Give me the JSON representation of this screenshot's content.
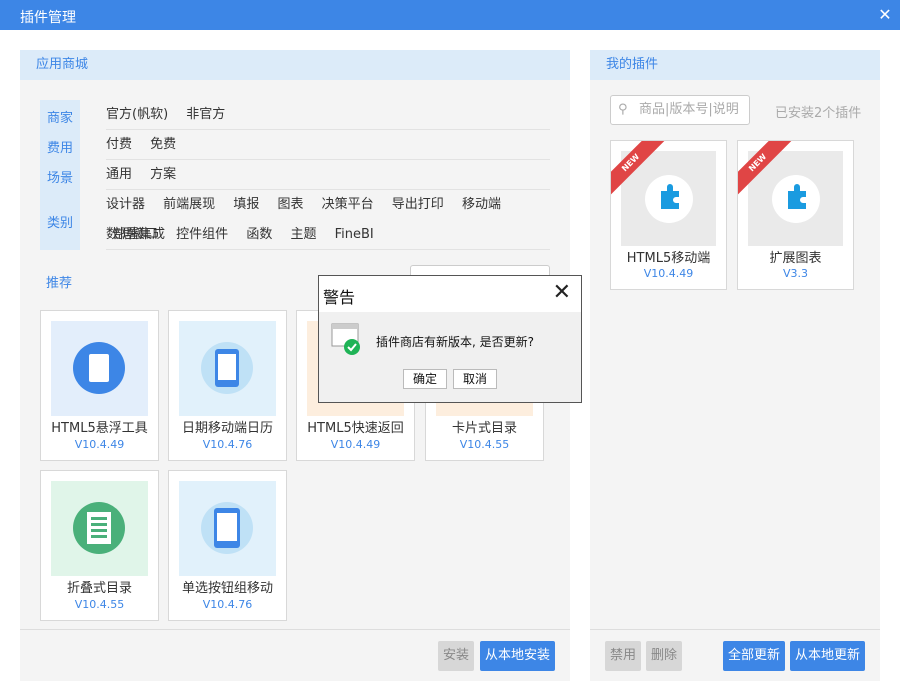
{
  "window": {
    "title": "插件管理",
    "close": "✕"
  },
  "store": {
    "header": "应用商城",
    "categories": {
      "vendor": "商家",
      "fee": "费用",
      "scene": "场景",
      "type": "类别"
    },
    "vendor_options": [
      "官方(帆软)",
      "非官方"
    ],
    "fee_options": [
      "付费",
      "免费"
    ],
    "scene_options": [
      "通用",
      "方案"
    ],
    "type_options_row1": [
      "设计器",
      "前端展现",
      "填报",
      "图表",
      "决策平台",
      "导出打印",
      "移动端",
      "部署集成"
    ],
    "type_options_row2": [
      "数据接口",
      "控件组件",
      "函数",
      "主题",
      "FineBI"
    ],
    "recommend": "推荐",
    "cards": [
      {
        "name": "HTML5悬浮工具",
        "version": "V10.4.49"
      },
      {
        "name": "日期移动端日历",
        "version": "V10.4.76"
      },
      {
        "name": "HTML5快速返回",
        "version": "V10.4.49"
      },
      {
        "name": "卡片式目录",
        "version": "V10.4.55"
      },
      {
        "name": "折叠式目录",
        "version": "V10.4.55"
      },
      {
        "name": "单选按钮组移动",
        "version": "V10.4.76"
      }
    ],
    "buttons": {
      "install": "安装",
      "install_local": "从本地安装"
    }
  },
  "mine": {
    "header": "我的插件",
    "search_placeholder": "商品|版本号|说明",
    "installed_count": "已安装2个插件",
    "plugins": [
      {
        "name": "HTML5移动端",
        "version": "V10.4.49",
        "badge": "NEW"
      },
      {
        "name": "扩展图表",
        "version": "V3.3",
        "badge": "NEW"
      }
    ],
    "buttons": {
      "disable": "禁用",
      "delete": "删除",
      "update_all": "全部更新",
      "update_local": "从本地更新"
    }
  },
  "dialog": {
    "title": "警告",
    "message": "插件商店有新版本, 是否更新?",
    "ok": "确定",
    "cancel": "取消"
  },
  "colors": {
    "accent": "#3d86e6",
    "panel_header": "#dcebf9",
    "badge": "#e04545",
    "success": "#1fb356"
  }
}
